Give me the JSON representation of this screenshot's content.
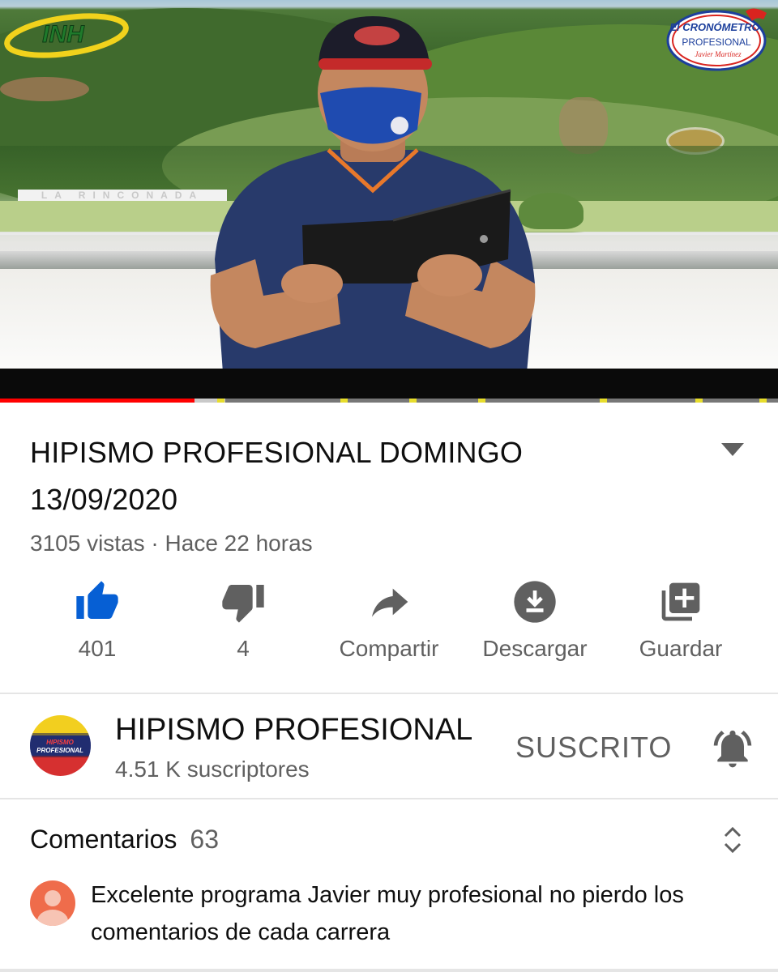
{
  "video": {
    "overlay_logo_left": "INH",
    "overlay_logo_right_line1": "El CRONÓMETRO",
    "overlay_logo_right_line2": "PROFESIONAL",
    "overlay_logo_right_line3": "Javier Martínez",
    "track_sign": "LA RINCONADA",
    "progress_fraction": 0.25,
    "buffered_fraction": 0.29,
    "chapter_markers": 7
  },
  "video_info": {
    "title": "HIPISMO PROFESIONAL DOMINGO 13/09/2020",
    "views": "3105 vistas",
    "separator": "·",
    "age": "Hace 22 horas"
  },
  "actions": {
    "like": {
      "icon": "thumbs-up-icon",
      "label": "401",
      "active": true
    },
    "dislike": {
      "icon": "thumbs-down-icon",
      "label": "4"
    },
    "share": {
      "icon": "share-icon",
      "label": "Compartir"
    },
    "download": {
      "icon": "download-icon",
      "label": "Descargar"
    },
    "save": {
      "icon": "add-to-playlist-icon",
      "label": "Guardar"
    }
  },
  "channel": {
    "name": "HIPISMO PROFESIONAL",
    "subscribers": "4.51 K suscriptores",
    "subscribed_label": "SUSCRITO",
    "avatar_text": "HIPISMO PROFESIONAL"
  },
  "comments": {
    "label": "Comentarios",
    "count": "63",
    "top_comment": "Excelente programa Javier muy profesional no pierdo los comentarios de cada carrera"
  },
  "colors": {
    "accent_like": "#065fd4",
    "progress_red": "#ff0000",
    "text_secondary": "#606060",
    "comment_avatar": "#ef6c4b"
  }
}
